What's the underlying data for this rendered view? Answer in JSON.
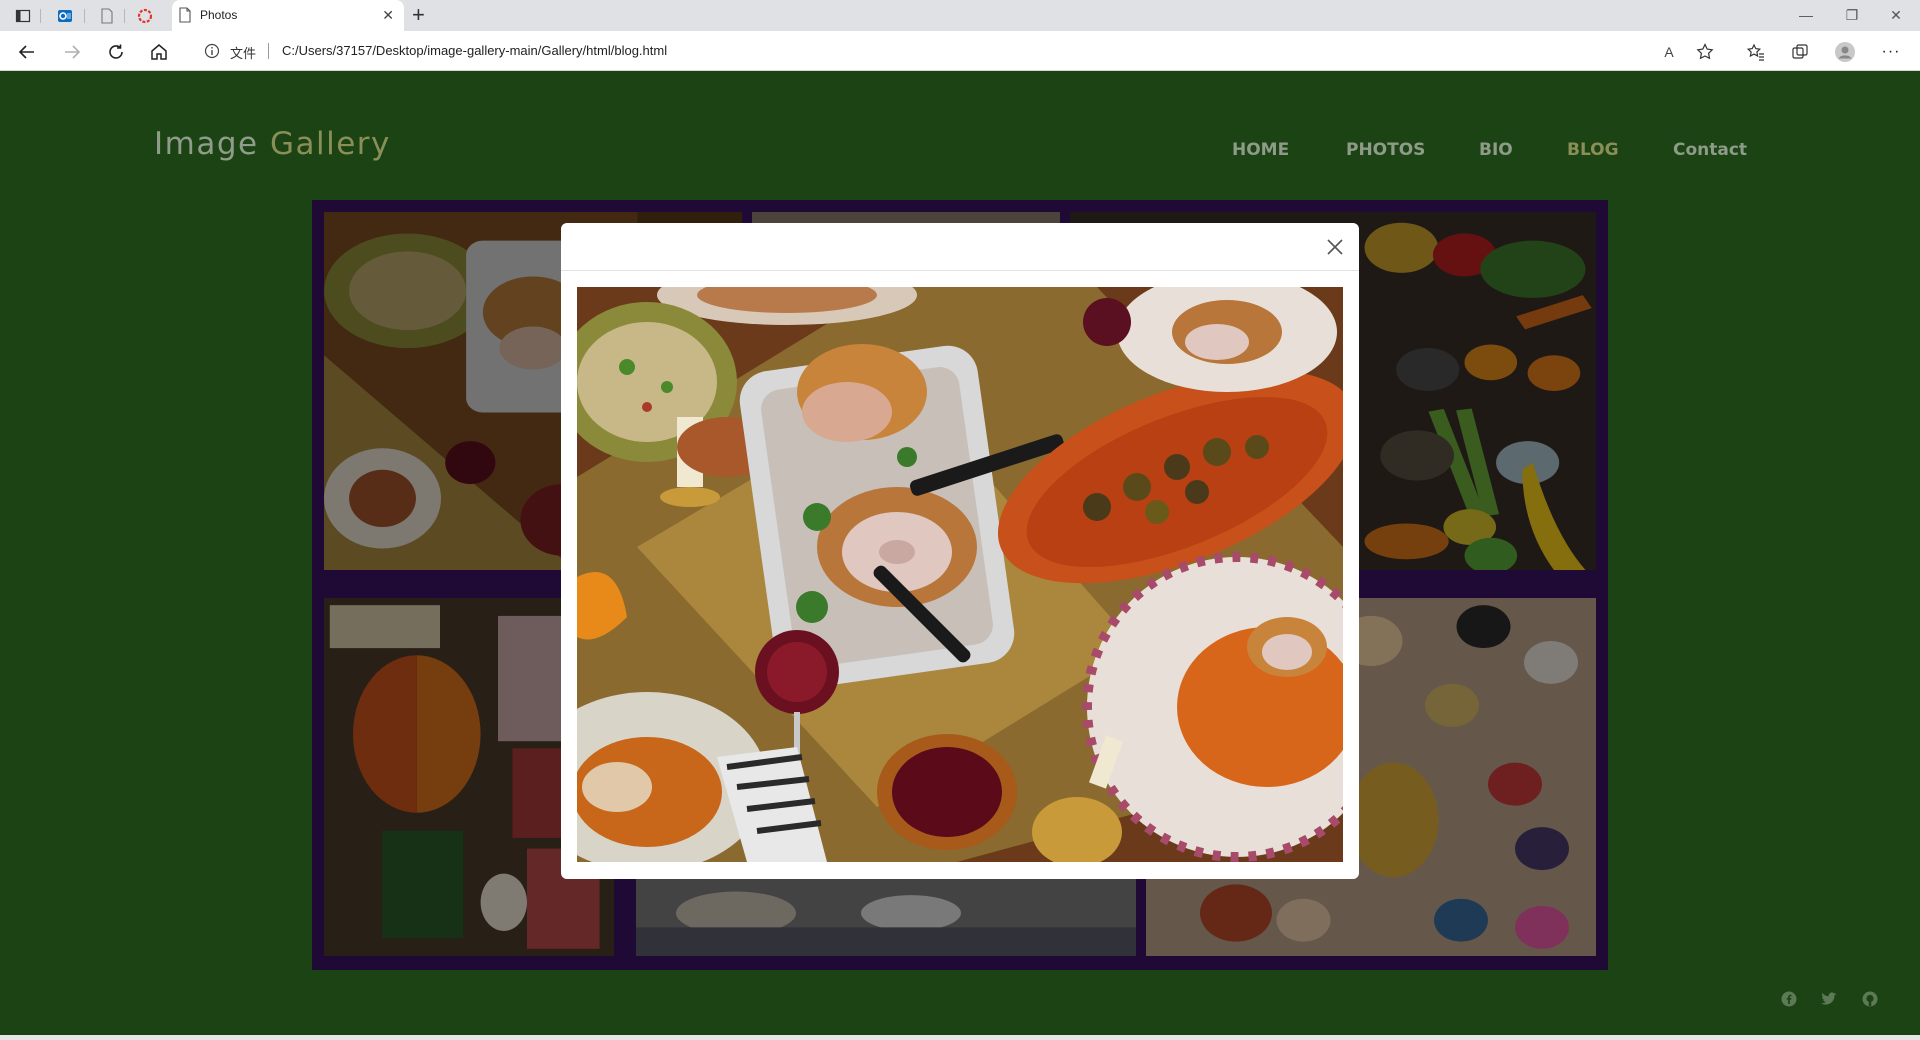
{
  "browser": {
    "tab_title": "Photos",
    "url_info_label": "文件",
    "url": "C:/Users/37157/Desktop/image-gallery-main/Gallery/html/blog.html",
    "read_aloud_label": "A",
    "icons": [
      "tab-actions-icon",
      "outlook-icon",
      "page-icon",
      "extension-icon",
      "back-icon",
      "forward-icon",
      "refresh-icon",
      "home-icon",
      "favorites-star-icon",
      "favorites-icon",
      "collections-icon",
      "profile-icon",
      "more-icon"
    ]
  },
  "site": {
    "logo_part1": "Image",
    "logo_part2": "Gallery",
    "nav": [
      {
        "label": "HOME",
        "active": false
      },
      {
        "label": "PHOTOS",
        "active": false
      },
      {
        "label": "BIO",
        "active": false
      },
      {
        "label": "BLOG",
        "active": true
      },
      {
        "label": "Contact",
        "active": false
      }
    ],
    "social_icons": [
      "facebook-icon",
      "twitter-icon",
      "github-icon"
    ]
  },
  "gallery": {
    "photos": [
      "holiday-feast",
      "dinner-table",
      "fresh-vegetables",
      "hotpot-spread",
      "breakfast-table",
      "fruit-and-sweets"
    ]
  },
  "modal": {
    "image_subject": "holiday-feast",
    "close_icon": "close-icon"
  },
  "colors": {
    "page_bg": "#1b4314",
    "gallery_frame": "#1f0a36",
    "nav_text": "#8e9b88",
    "nav_active": "#8a8f57"
  }
}
